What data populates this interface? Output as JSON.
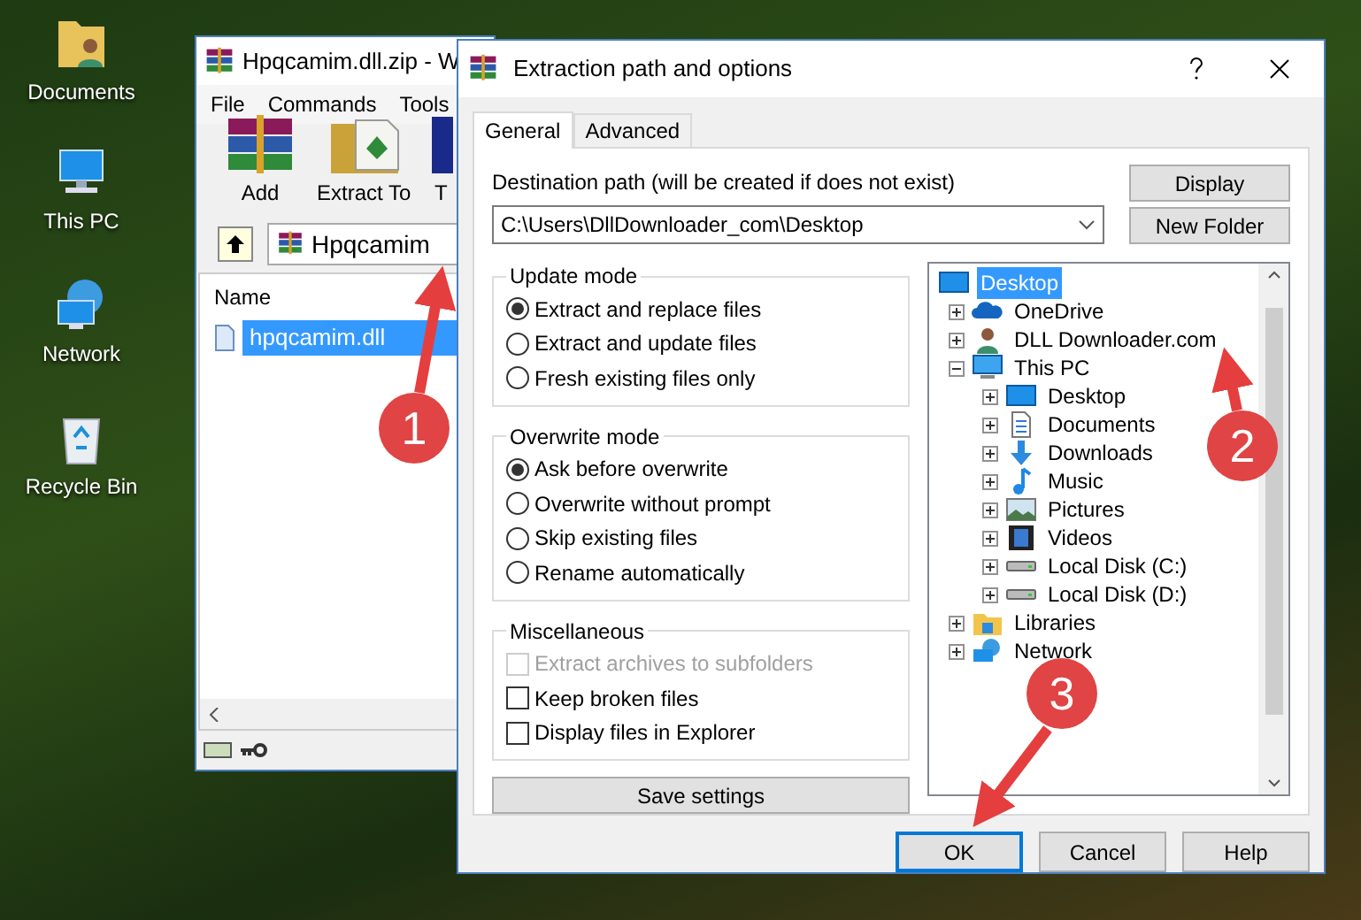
{
  "desktop": {
    "icons": [
      {
        "label": "Documents",
        "kind": "user-folder"
      },
      {
        "label": "This PC",
        "kind": "computer"
      },
      {
        "label": "Network",
        "kind": "network"
      },
      {
        "label": "Recycle Bin",
        "kind": "recycle"
      }
    ]
  },
  "archiver": {
    "title": "Hpqcamim.dll.zip - W",
    "menu": [
      "File",
      "Commands",
      "Tools"
    ],
    "toolbar": [
      {
        "label": "Add",
        "kind": "add"
      },
      {
        "label": "Extract To",
        "kind": "extract"
      },
      {
        "label": "T",
        "kind": "test"
      }
    ],
    "address": "Hpqcamim",
    "columns": [
      "Name"
    ],
    "files": [
      {
        "name": "hpqcamim.dll",
        "selected": true
      }
    ]
  },
  "dialog": {
    "title": "Extraction path and options",
    "tabs": [
      {
        "label": "General",
        "selected": true
      },
      {
        "label": "Advanced",
        "selected": false
      }
    ],
    "destination_label": "Destination path (will be created if does not exist)",
    "destination_value": "C:\\Users\\DllDownloader_com\\Desktop",
    "side_buttons": [
      "Display",
      "New Folder"
    ],
    "groups": [
      {
        "title": "Update mode",
        "kind": "radio",
        "options": [
          {
            "label": "Extract and replace files",
            "selected": true,
            "disabled": false
          },
          {
            "label": "Extract and update files",
            "selected": false,
            "disabled": false
          },
          {
            "label": "Fresh existing files only",
            "selected": false,
            "disabled": false
          }
        ]
      },
      {
        "title": "Overwrite mode",
        "kind": "radio",
        "options": [
          {
            "label": "Ask before overwrite",
            "selected": true,
            "disabled": false
          },
          {
            "label": "Overwrite without prompt",
            "selected": false,
            "disabled": false
          },
          {
            "label": "Skip existing files",
            "selected": false,
            "disabled": false
          },
          {
            "label": "Rename automatically",
            "selected": false,
            "disabled": false
          }
        ]
      },
      {
        "title": "Miscellaneous",
        "kind": "checkbox",
        "options": [
          {
            "label": "Extract archives to subfolders",
            "checked": false,
            "disabled": true
          },
          {
            "label": "Keep broken files",
            "checked": false,
            "disabled": false
          },
          {
            "label": "Display files in Explorer",
            "checked": false,
            "disabled": false
          }
        ]
      }
    ],
    "save_button": "Save settings",
    "tree": [
      {
        "label": "Desktop",
        "kind": "desktop",
        "selected": true,
        "children": [
          {
            "label": "OneDrive",
            "kind": "cloud",
            "selected": false,
            "expanded": false
          },
          {
            "label": "DLL Downloader.com",
            "kind": "user",
            "selected": false,
            "expanded": false
          },
          {
            "label": "This PC",
            "kind": "computer",
            "selected": false,
            "expanded": true,
            "children": [
              {
                "label": "Desktop",
                "kind": "desktop",
                "selected": false,
                "expanded": false
              },
              {
                "label": "Documents",
                "kind": "document",
                "selected": false,
                "expanded": false
              },
              {
                "label": "Downloads",
                "kind": "download",
                "selected": false,
                "expanded": false
              },
              {
                "label": "Music",
                "kind": "music",
                "selected": false,
                "expanded": false
              },
              {
                "label": "Pictures",
                "kind": "picture",
                "selected": false,
                "expanded": false
              },
              {
                "label": "Videos",
                "kind": "video",
                "selected": false,
                "expanded": false
              },
              {
                "label": "Local Disk (C:)",
                "kind": "drive",
                "selected": false,
                "expanded": false
              },
              {
                "label": "Local Disk (D:)",
                "kind": "drive",
                "selected": false,
                "expanded": false
              }
            ]
          },
          {
            "label": "Libraries",
            "kind": "library",
            "selected": false,
            "expanded": false
          },
          {
            "label": "Network",
            "kind": "network",
            "selected": false,
            "expanded": false
          }
        ]
      }
    ],
    "buttons": [
      {
        "label": "OK",
        "default": true
      },
      {
        "label": "Cancel",
        "default": false
      },
      {
        "label": "Help",
        "default": false
      }
    ]
  },
  "callouts": [
    {
      "number": "1"
    },
    {
      "number": "2"
    },
    {
      "number": "3"
    }
  ]
}
